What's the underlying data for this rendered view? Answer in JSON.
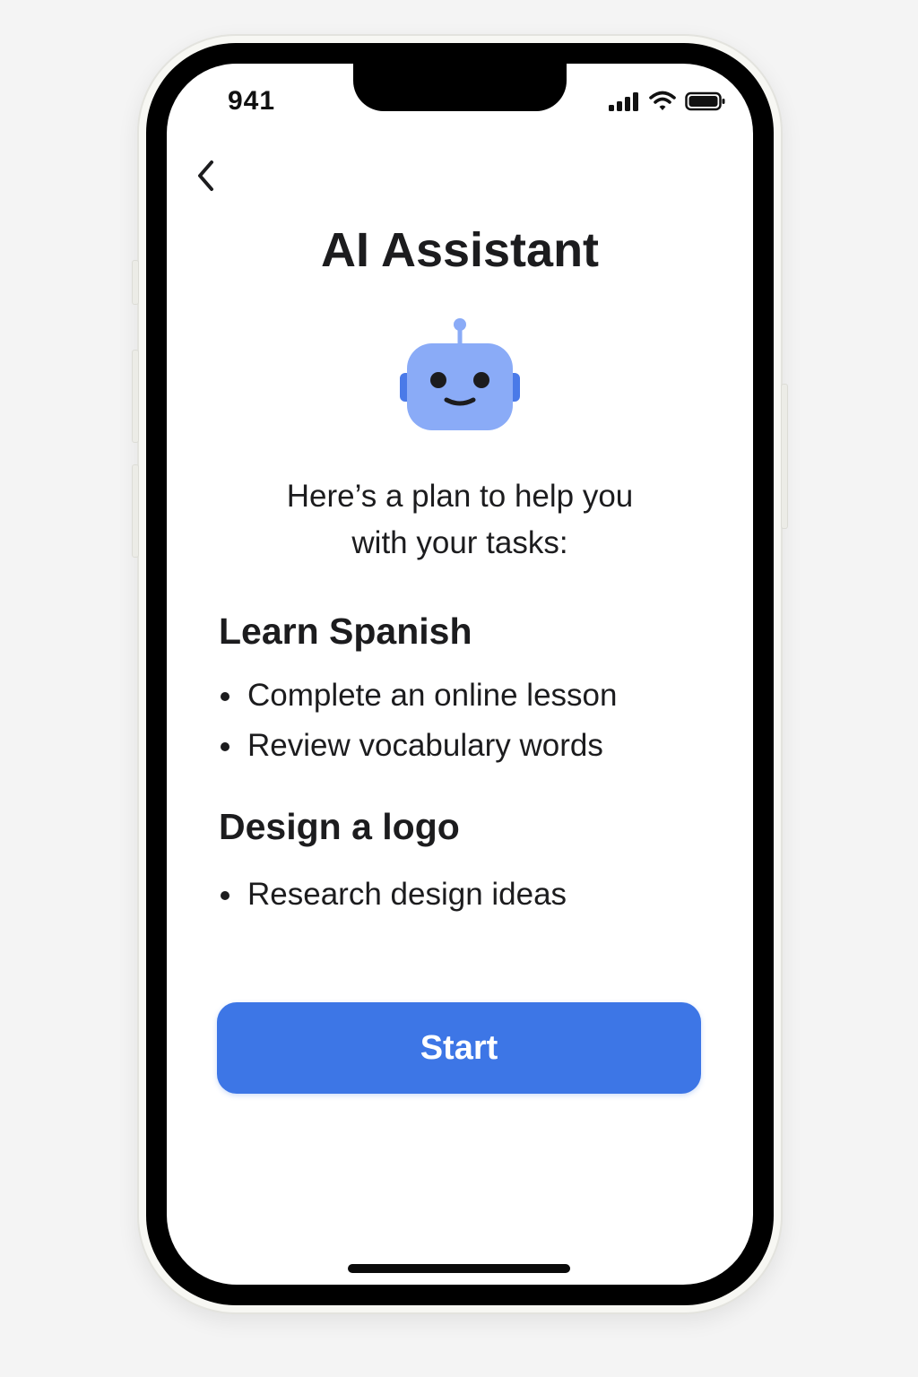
{
  "status_bar": {
    "time": "941",
    "icons": [
      "signal-icon",
      "wifi-icon",
      "battery-icon"
    ]
  },
  "nav": {
    "back_icon": "chevron-left-icon"
  },
  "header": {
    "title": "AI Assistant"
  },
  "assistant": {
    "avatar_icon": "robot-icon",
    "intro_line1": "Here’s a plan to help you",
    "intro_line2": "with your tasks:"
  },
  "plan": {
    "sections": [
      {
        "title": "Learn Spanish",
        "tasks": [
          "Complete an online lesson",
          "Review vocabulary words"
        ]
      },
      {
        "title": "Design a logo",
        "tasks": [
          "Research design ideas"
        ]
      }
    ]
  },
  "actions": {
    "start_label": "Start"
  },
  "colors": {
    "accent": "#3d76e6",
    "robot_face": "#8aabf7",
    "robot_ears": "#4a7ae8",
    "text": "#1c1c1e"
  }
}
